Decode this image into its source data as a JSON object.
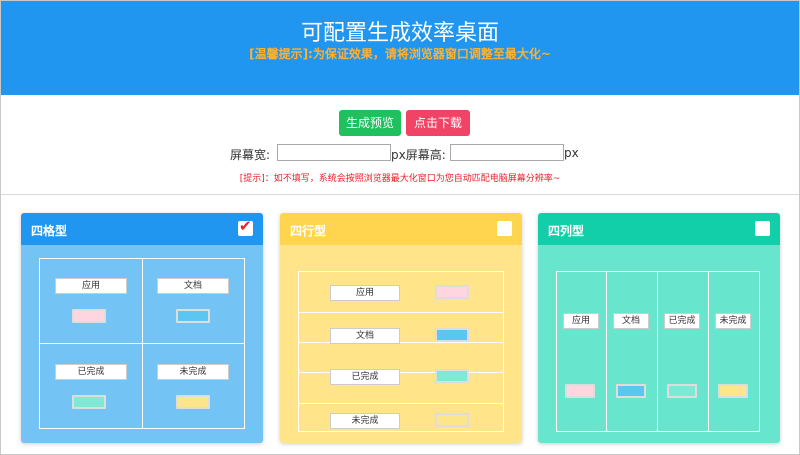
{
  "header": {
    "title": "可配置生成效率桌面",
    "tip": "[温馨提示]:为保证效果，请将浏览器窗口调整至最大化~"
  },
  "controls": {
    "preview_label": "生成预览",
    "download_label": "点击下载",
    "width_label": "屏幕宽:",
    "height_label": "px屏幕高:",
    "unit": "px",
    "width_value": "",
    "height_value": "",
    "hint": "[提示]：如不填写，系统会按照浏览器最大化窗口为您自动匹配电脑屏幕分辨率~"
  },
  "cards": [
    {
      "title": "四格型",
      "checked": true,
      "head_color": "#2196f0",
      "cells": [
        "应用",
        "文档",
        "已完成",
        "未完成"
      ]
    },
    {
      "title": "四行型",
      "checked": false,
      "head_color": "#ffd54f",
      "cells": [
        "应用",
        "文档",
        "已完成",
        "未完成"
      ]
    },
    {
      "title": "四列型",
      "checked": false,
      "head_color": "#12cfaa",
      "cells": [
        "应用",
        "文档",
        "已完成",
        "未完成"
      ]
    }
  ],
  "swatch_colors": {
    "pink": "#ffd6e0",
    "blue": "#5cc6f2",
    "teal": "#7eead5",
    "yellow": "#fde58a"
  },
  "checkmark": "✔"
}
